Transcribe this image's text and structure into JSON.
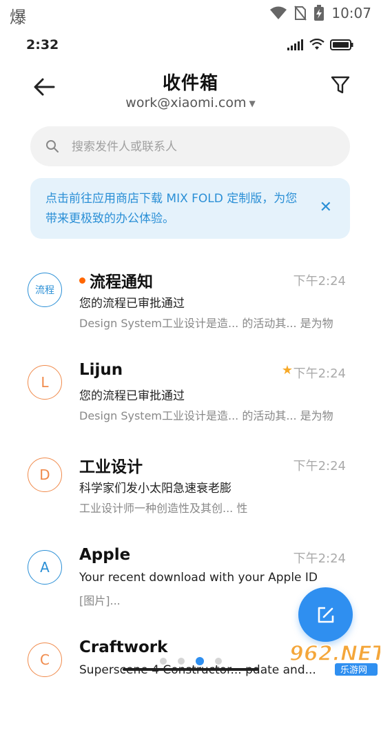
{
  "outer_status": {
    "left_glyph": "爆",
    "time": "10:07"
  },
  "inner_status": {
    "time": "2:32"
  },
  "header": {
    "title": "收件箱",
    "account": "work@xiaomi.com"
  },
  "search": {
    "placeholder": "搜索发件人或联系人"
  },
  "banner": {
    "text": "点击前往应用商店下载 MIX FOLD 定制版，为您带来更极致的办公体验。",
    "close": "✕"
  },
  "mails": [
    {
      "avatar": "流程",
      "avatar_color": "#2a8fd6",
      "unread": true,
      "starred": false,
      "sender": "流程通知",
      "time": "下午2:24",
      "subject": "您的流程已审批通过",
      "preview": "Design System工业设计是造... 的活动其... 是为物"
    },
    {
      "avatar": "L",
      "avatar_color": "#f08a4b",
      "unread": false,
      "starred": true,
      "sender": "Lijun",
      "time": "下午2:24",
      "subject": "您的流程已审批通过",
      "preview": "Design System工业设计是造... 的活动其... 是为物"
    },
    {
      "avatar": "D",
      "avatar_color": "#f08a4b",
      "unread": false,
      "starred": false,
      "sender": "工业设计",
      "time": "下午2:24",
      "subject": "科学家们发小太阳急速衰老膨",
      "preview": "工业设计师一种创造性及其创... 性"
    },
    {
      "avatar": "A",
      "avatar_color": "#2a8fd6",
      "unread": false,
      "starred": false,
      "sender": "Apple",
      "time": "下午2:24",
      "subject": "Your recent download with  your Apple ID",
      "preview": "[图片]..."
    },
    {
      "avatar": "C",
      "avatar_color": "#f08a4b",
      "unread": false,
      "starred": false,
      "sender": "Craftwork",
      "time": "",
      "subject": "Superscene 4 Constructor... pdate and...",
      "preview": ""
    }
  ],
  "pager": {
    "count": 4,
    "active": 2
  },
  "watermark": {
    "text": "962.NET",
    "sub": "乐游网"
  },
  "colors": {
    "accent": "#2f8ff0",
    "orange": "#f08a4b",
    "blue": "#2a8fd6",
    "unread_dot": "#ff6600",
    "star": "#f7a928"
  }
}
